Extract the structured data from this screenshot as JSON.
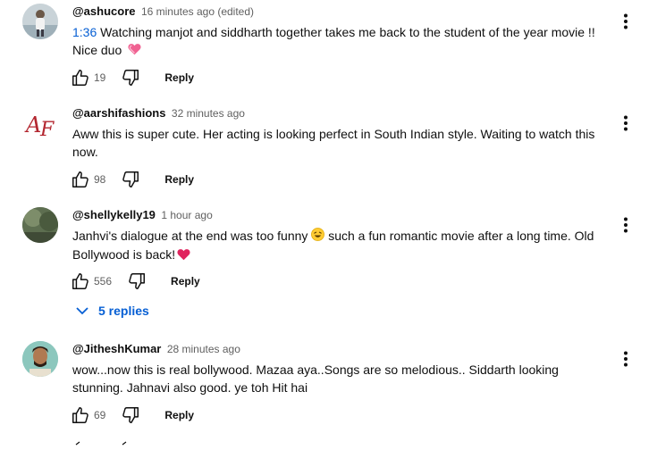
{
  "comments": [
    {
      "author": "@ashucore",
      "time": "16 minutes ago (edited)",
      "timestamp": "1:36",
      "text_line1": " Watching manjot and siddharth together takes me back to the student of the year movie !!",
      "text_line2": "Nice duo",
      "emoji": "sparkling-heart",
      "likes": "19",
      "reply_label": "Reply"
    },
    {
      "author": "@aarshifashions",
      "time": "32 minutes ago",
      "text_line1": "Aww this is super cute. Her acting is looking perfect in South Indian style. Waiting to watch this",
      "text_line2": "now.",
      "avatar_initials": "AF",
      "likes": "98",
      "reply_label": "Reply"
    },
    {
      "author": "@shellykelly19",
      "time": "1 hour ago",
      "text_line1a": "Janhvi's dialogue at the end was too funny ",
      "text_line1b": " such a fun romantic movie after a long time. Old",
      "text_line2": "Bollywood is back!",
      "likes": "556",
      "reply_label": "Reply",
      "replies_label": "5 replies"
    },
    {
      "author": "@JitheshKumar",
      "time": "28 minutes ago",
      "text_line1": "wow...now this is real bollywood. Mazaa aya..Songs are so melodious.. Siddarth looking",
      "text_line2": "stunning. Jahnavi also good. ye toh Hit hai",
      "likes": "69",
      "reply_label": "Reply"
    }
  ],
  "colors": {
    "link": "#065fd4",
    "secondary_text": "#606060",
    "primary_text": "#0f0f0f",
    "heart": "#e0245e"
  }
}
